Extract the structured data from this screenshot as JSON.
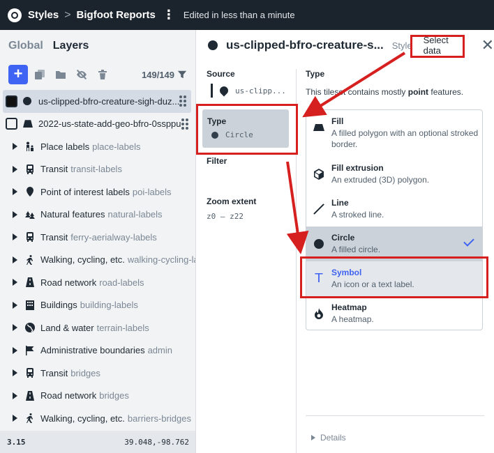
{
  "topbar": {
    "app_label": "Styles",
    "breadcrumb_sep": ">",
    "style_name": "Bigfoot Reports",
    "status": "Edited in less than a minute"
  },
  "left_panel": {
    "tabs": [
      "Global",
      "Layers"
    ],
    "layer_count": "149/149",
    "layers": [
      {
        "kind": "data",
        "name": "us-clipped-bfro-creature-sigh-duz...",
        "selected": true,
        "swatch": "filled",
        "icon": "circle-icon"
      },
      {
        "kind": "data",
        "name": "2022-us-state-add-geo-bfro-0ssppu",
        "selected": false,
        "swatch": "outline",
        "icon": "fill-icon"
      },
      {
        "kind": "group",
        "name": "Place labels",
        "id": "place-labels",
        "icon": "people-icon"
      },
      {
        "kind": "group",
        "name": "Transit",
        "id": "transit-labels",
        "icon": "bus-icon"
      },
      {
        "kind": "group",
        "name": "Point of interest labels",
        "id": "poi-labels",
        "icon": "pin-icon"
      },
      {
        "kind": "group",
        "name": "Natural features",
        "id": "natural-labels",
        "icon": "tree-icon"
      },
      {
        "kind": "group",
        "name": "Transit",
        "id": "ferry-aerialway-labels",
        "icon": "bus-icon"
      },
      {
        "kind": "group",
        "name": "Walking, cycling, etc.",
        "id": "walking-cycling-lal",
        "icon": "walker-icon"
      },
      {
        "kind": "group",
        "name": "Road network",
        "id": "road-labels",
        "icon": "road-icon"
      },
      {
        "kind": "group",
        "name": "Buildings",
        "id": "building-labels",
        "icon": "building-icon"
      },
      {
        "kind": "group",
        "name": "Land & water",
        "id": "terrain-labels",
        "icon": "globe-icon"
      },
      {
        "kind": "group",
        "name": "Administrative boundaries",
        "id": "admin",
        "icon": "flag-icon"
      },
      {
        "kind": "group",
        "name": "Transit",
        "id": "bridges",
        "icon": "bus-icon"
      },
      {
        "kind": "group",
        "name": "Road network",
        "id": "bridges",
        "icon": "road-icon"
      },
      {
        "kind": "group",
        "name": "Walking, cycling, etc.",
        "id": "barriers-bridges",
        "icon": "walker-icon"
      }
    ],
    "status": {
      "zoom": "3.15",
      "coords": "39.048,-98.762"
    }
  },
  "right_panel": {
    "layer_name": "us-clipped-bfro-creature-s...",
    "tabs": [
      "Style",
      "Select data"
    ],
    "active_tab": "Select data",
    "source_label": "Source",
    "source_value": "us-clipp...",
    "type_label": "Type",
    "type_value": "Circle",
    "filter_label": "Filter",
    "zoom_label": "Zoom extent",
    "zoom_value": "z0 – z22",
    "type_heading": "Type",
    "type_desc_pre": "This tileset contains mostly",
    "type_desc_bold": "point",
    "type_desc_post": "features.",
    "options": [
      {
        "label": "Fill",
        "desc": "A filled polygon with an optional stroked border.",
        "icon": "fill-icon"
      },
      {
        "label": "Fill extrusion",
        "desc": "An extruded (3D) polygon.",
        "icon": "cube-icon"
      },
      {
        "label": "Line",
        "desc": "A stroked line.",
        "icon": "line-icon"
      },
      {
        "label": "Circle",
        "desc": "A filled circle.",
        "icon": "circle-icon",
        "selected": true
      },
      {
        "label": "Symbol",
        "desc": "An icon or a text label.",
        "icon": "symbol-icon",
        "glyph": "T"
      },
      {
        "label": "Heatmap",
        "desc": "A heatmap.",
        "icon": "flame-icon"
      }
    ],
    "details_label": "Details"
  },
  "colors": {
    "accent": "#3f63f2",
    "annotation": "#d62020",
    "topbar": "#1b232c"
  }
}
